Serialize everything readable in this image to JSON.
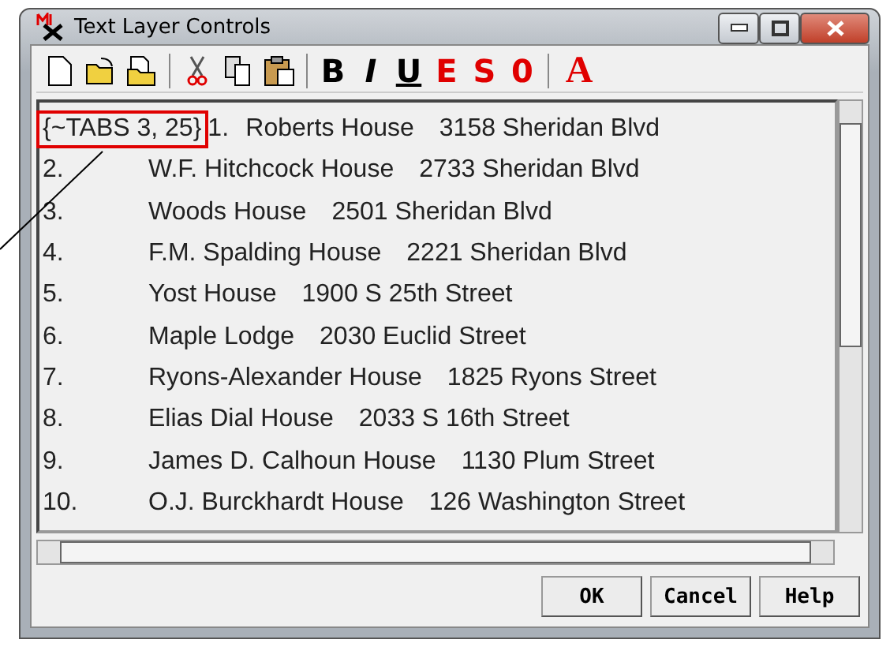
{
  "window": {
    "title": "Text Layer Controls"
  },
  "toolbar": [
    {
      "kind": "icon"
    },
    {
      "kind": "icon"
    },
    {
      "kind": "icon"
    },
    {
      "kind": "separator"
    },
    {
      "kind": "icon"
    },
    {
      "kind": "icon"
    },
    {
      "kind": "icon"
    },
    {
      "kind": "separator"
    },
    {
      "kind": "glyph",
      "label": "B"
    },
    {
      "kind": "glyph",
      "label": "I"
    },
    {
      "kind": "glyph",
      "label": "U"
    },
    {
      "kind": "glyph",
      "label": "E"
    },
    {
      "kind": "glyph",
      "label": "S"
    },
    {
      "kind": "glyph",
      "label": "0"
    },
    {
      "kind": "separator"
    },
    {
      "kind": "glyph",
      "label": "A"
    }
  ],
  "editor": {
    "lines": [
      {
        "prefix": "{~TABS 3, 25}",
        "number": "1.",
        "name": "Roberts House",
        "address": "3158 Sheridan Blvd"
      },
      {
        "number": "2.",
        "name": "W.F. Hitchcock House",
        "address": "2733 Sheridan Blvd"
      },
      {
        "number": "3.",
        "name": "Woods House",
        "address": "2501 Sheridan Blvd"
      },
      {
        "number": "4.",
        "name": "F.M. Spalding House",
        "address": "2221 Sheridan Blvd"
      },
      {
        "number": "5.",
        "name": "Yost House",
        "address": "1900 S 25th Street"
      },
      {
        "number": "6.",
        "name": "Maple Lodge",
        "address": "2030 Euclid Street"
      },
      {
        "number": "7.",
        "name": "Ryons-Alexander House",
        "address": "1825 Ryons Street"
      },
      {
        "number": "8.",
        "name": "Elias Dial House",
        "address": "2033 S 16th Street"
      },
      {
        "number": "9.",
        "name": "James D. Calhoun House",
        "address": "1130 Plum Street"
      },
      {
        "number": "10.",
        "name": "O.J. Burckhardt House",
        "address": "126 Washington Street"
      }
    ]
  },
  "buttons": [
    "OK",
    "Cancel",
    "Help"
  ]
}
